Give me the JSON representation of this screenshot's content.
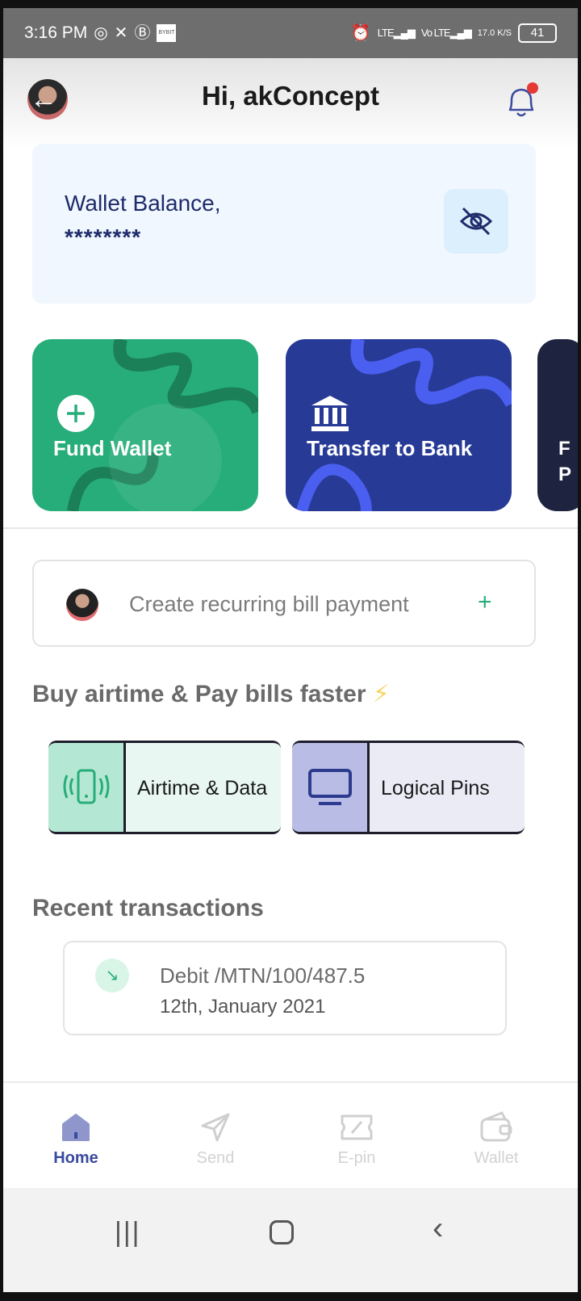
{
  "status_bar": {
    "time": "3:16 PM",
    "left_icons": [
      "whatsapp-icon",
      "x-icon",
      "b-icon",
      "bybit-icon"
    ],
    "bybit_badge": "BYBIT",
    "network": "LTE",
    "network2": "Vo LTE",
    "speed": "17.0 K/S",
    "battery": "41"
  },
  "header": {
    "greeting": "Hi, akConcept"
  },
  "wallet": {
    "label": "Wallet Balance,",
    "amount": "********"
  },
  "actions": [
    {
      "label": "Fund Wallet",
      "color": "#27ad7a"
    },
    {
      "label": "Transfer to Bank",
      "color": "#273a96"
    },
    {
      "label": "F P",
      "color": "#1e2440"
    }
  ],
  "recurring": {
    "label": "Create recurring bill payment",
    "plus": "+"
  },
  "bills": {
    "title": "Buy airtime & Pay bills faster",
    "items": [
      {
        "label": "Airtime & Data"
      },
      {
        "label": "Logical Pins"
      }
    ]
  },
  "recent": {
    "title": "Recent transactions",
    "items": [
      {
        "title": "Debit /MTN/100/487.5",
        "date": "12th, January 2021"
      }
    ]
  },
  "bottom_nav": {
    "items": [
      {
        "label": "Home",
        "active": true
      },
      {
        "label": "Send"
      },
      {
        "label": "E-pin"
      },
      {
        "label": "Wallet"
      }
    ]
  },
  "colors": {
    "accent_green": "#27ad7a",
    "accent_blue": "#273a96",
    "notification_dot": "#e53935"
  }
}
